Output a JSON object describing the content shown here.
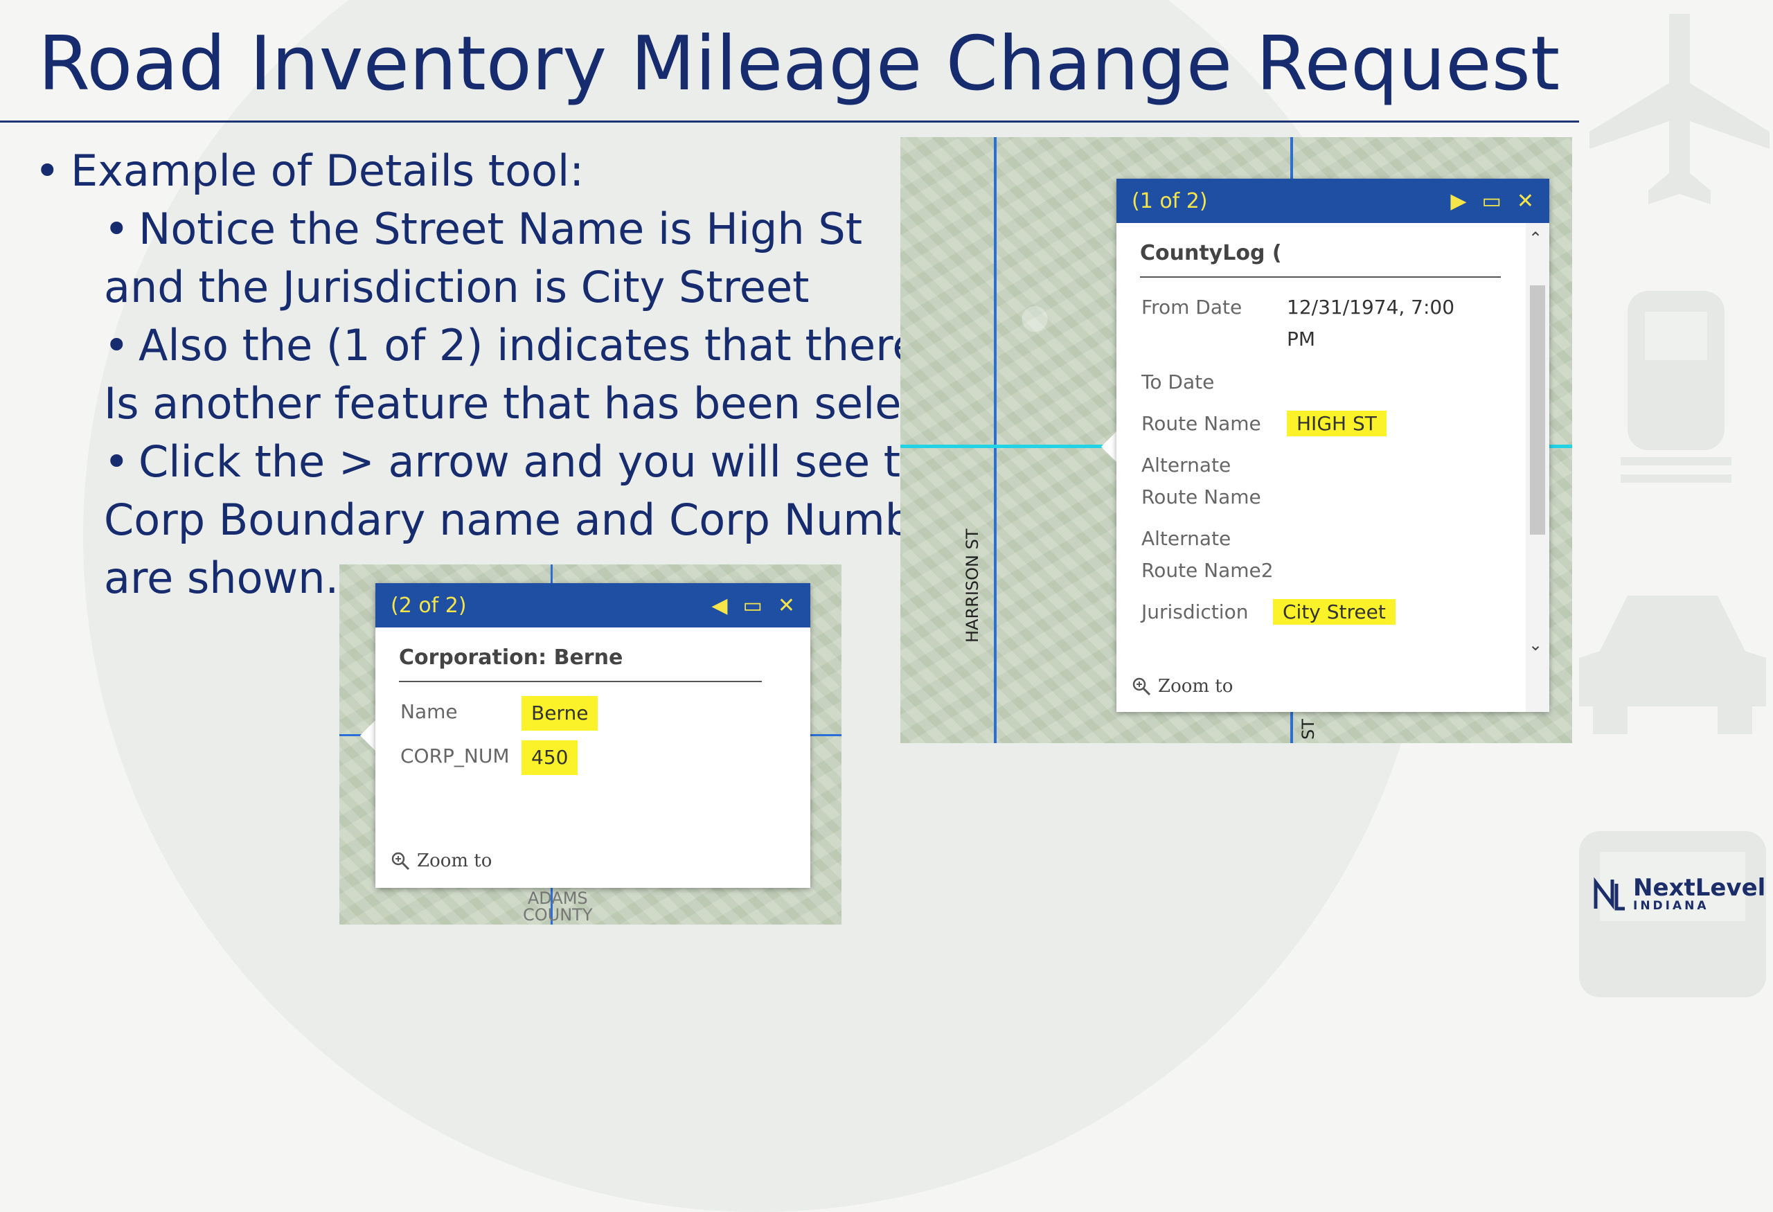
{
  "slide": {
    "title": "Road Inventory Mileage Change Request",
    "bullet_main": "Example of Details tool:",
    "sub1_line1": "Notice the Street Name is High St",
    "sub1_line2": "and the Jurisdiction is City Street",
    "sub2_line1": "Also the (1 of 2) indicates that there",
    "sub2_line2": "Is another feature that has been selected",
    "sub3_line1": "Click the > arrow and you will see that",
    "sub3_line2": "Corp Boundary name and Corp Number",
    "sub3_line3": "are shown."
  },
  "popup_left": {
    "counter": "(2 of 2)",
    "title": "Corporation: Berne",
    "fields": [
      {
        "label": "Name",
        "value": "Berne"
      },
      {
        "label": "CORP_NUM",
        "value": "450"
      }
    ],
    "zoom_label": "Zoom to",
    "map_label_1": "ADAMS",
    "map_label_2": "COUNTY"
  },
  "popup_right": {
    "counter": "(1 of 2)",
    "title": "CountyLog (",
    "fields": [
      {
        "label": "From Date",
        "value": "12/31/1974, 7:00"
      },
      {
        "label": "",
        "value": "PM"
      },
      {
        "label": "To Date",
        "value": ""
      },
      {
        "label": "Route Name",
        "value": "HIGH ST"
      },
      {
        "label": "Alternate",
        "value": ""
      },
      {
        "label": "Route Name",
        "value": ""
      },
      {
        "label": "Alternate",
        "value": ""
      },
      {
        "label": "Route Name2",
        "value": ""
      },
      {
        "label": "Jurisdiction",
        "value": "City Street"
      }
    ],
    "zoom_label": "Zoom to",
    "street_label_1": "HARRISON ST",
    "street_label_2": "ST"
  },
  "logo": {
    "line1": "NextLevel",
    "line2": "INDIANA"
  },
  "colors": {
    "title": "#162c6e",
    "popup_header": "#1f4fa3",
    "popup_header_text": "#f6e54a",
    "highlight": "#fbf229",
    "route_line": "#2a6fd8",
    "selected_line": "#22d3e6"
  }
}
